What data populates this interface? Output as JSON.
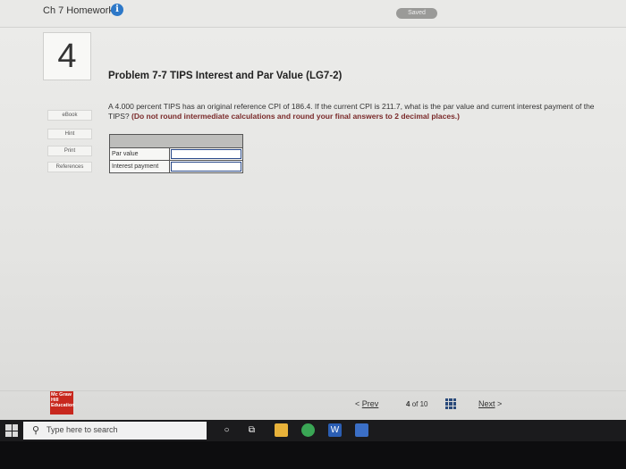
{
  "header": {
    "assignment_title": "Ch 7 Homework",
    "info_icon": "i",
    "saved_label": "Saved"
  },
  "question": {
    "number": "4",
    "title": "Problem 7-7 TIPS Interest and Par Value (LG7-2)",
    "text": "A 4.000 percent TIPS has an original reference CPI of 186.4. If the current CPI is 211.7, what is the par value and current interest payment of the TIPS?",
    "instructions": "(Do not round intermediate calculations and round your final answers to 2 decimal places.)"
  },
  "sidebar": {
    "items": [
      {
        "label": "eBook"
      },
      {
        "label": "Hint"
      },
      {
        "label": "Print"
      },
      {
        "label": "References"
      }
    ]
  },
  "answer_table": {
    "rows": [
      {
        "label": "Par value",
        "value": ""
      },
      {
        "label": "Interest payment",
        "value": ""
      }
    ]
  },
  "footer": {
    "logo_text": "Mc Graw Hill Education",
    "prev_label": "Prev",
    "prev_arrow": "<",
    "page_current": "4",
    "page_sep": "of",
    "page_total": "10",
    "next_label": "Next",
    "next_arrow": ">"
  },
  "taskbar": {
    "search_placeholder": "Type here to search",
    "icons": [
      "windows-start-icon",
      "search-icon",
      "cortana-icon",
      "task-view-icon",
      "file-explorer-icon",
      "chrome-icon",
      "word-icon",
      "photos-icon"
    ]
  },
  "colors": {
    "info_blue": "#2d78c8",
    "logo_red": "#c8281e",
    "instruction_red": "#7a2a2a",
    "taskbar": "#1b1b1d"
  }
}
